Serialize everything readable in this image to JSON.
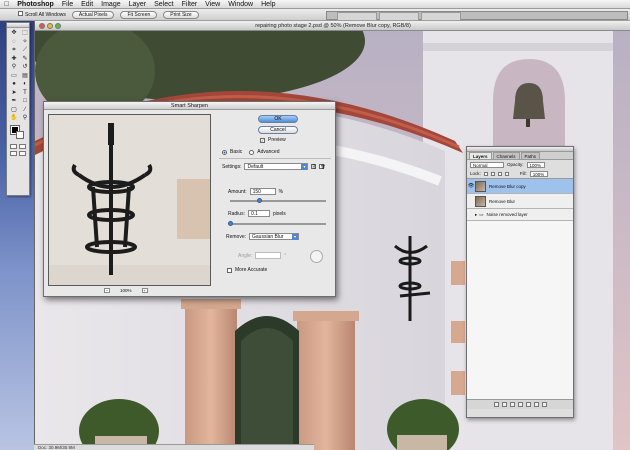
{
  "menubar": {
    "apple": "",
    "items": [
      "Photoshop",
      "File",
      "Edit",
      "Image",
      "Layer",
      "Select",
      "Filter",
      "View",
      "Window",
      "Help"
    ]
  },
  "options_bar": {
    "scroll_all_label": "Scroll All Windows",
    "actual_pixels": "Actual Pixels",
    "fit_screen": "Fit Screen",
    "print_size": "Print Size"
  },
  "document": {
    "title": "repairing photo stage 2.psd @ 50% (Remove Blur copy, RGB/8)",
    "status": "Doc: 30.9M/30.9M"
  },
  "dialog": {
    "title": "Smart Sharpen",
    "ok": "OK",
    "cancel": "Cancel",
    "preview_label": "Preview",
    "preview_checked": true,
    "basic_label": "Basic",
    "advanced_label": "Advanced",
    "mode_selected": "basic",
    "settings_label": "Settings:",
    "settings_value": "Default",
    "amount_label": "Amount:",
    "amount_value": "150",
    "amount_unit": "%",
    "amount_fraction": 0.3,
    "radius_label": "Radius:",
    "radius_value": "0.1",
    "radius_unit": "pixels",
    "radius_fraction": 0.0,
    "remove_label": "Remove:",
    "remove_value": "Gaussian Blur",
    "angle_label": "Angle:",
    "angle_value": "",
    "more_accurate_label": "More Accurate",
    "more_accurate_checked": false,
    "zoom_minus": "−",
    "zoom_level": "100%",
    "zoom_plus": "+"
  },
  "layers_panel": {
    "tabs": [
      "Layers",
      "Channels",
      "Paths"
    ],
    "blend_mode": "Normal",
    "opacity_label": "Opacity:",
    "opacity_value": "100%",
    "lock_label": "Lock:",
    "fill_label": "Fill:",
    "fill_value": "100%",
    "layers": [
      {
        "name": "Remove Blur copy",
        "selected": true,
        "visible": true
      },
      {
        "name": "Remove Blur",
        "selected": false,
        "visible": false
      }
    ],
    "group": {
      "name": "Noise removed layer",
      "visible": false
    }
  },
  "icons": {
    "eye": "eye-icon",
    "folder": "folder-icon",
    "lock": "lock-icon"
  }
}
